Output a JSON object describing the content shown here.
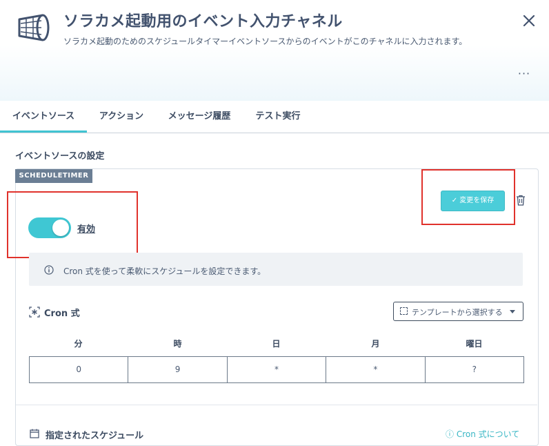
{
  "header": {
    "title": "ソラカメ起動用のイベント入力チャネル",
    "subtitle": "ソラカメ起動のためのスケジュールタイマーイベントソースからのイベントがこのチャネルに入力されます。",
    "more_label": "···"
  },
  "tabs": [
    {
      "label": "イベントソース",
      "active": true
    },
    {
      "label": "アクション",
      "active": false
    },
    {
      "label": "メッセージ履歴",
      "active": false
    },
    {
      "label": "テスト実行",
      "active": false
    }
  ],
  "section": {
    "title": "イベントソースの設定"
  },
  "card": {
    "badge": "SCHEDULETIMER",
    "save_label": "✓ 変更を保存",
    "toggle_label": "有効",
    "toggle_on": true,
    "info_text": "Cron 式を使って柔軟にスケジュールを設定できます。",
    "cron_label": "Cron 式",
    "template_placeholder": "テンプレートから選択する",
    "cron_columns": [
      "分",
      "時",
      "日",
      "月",
      "曜日"
    ],
    "cron_values": [
      "0",
      "9",
      "*",
      "*",
      "?"
    ],
    "schedule_label": "指定されたスケジュール",
    "about_cron_label": "Cron 式について"
  },
  "colors": {
    "accent": "#40c4d2",
    "badge": "#6b7e94",
    "highlight": "#e0312b"
  }
}
